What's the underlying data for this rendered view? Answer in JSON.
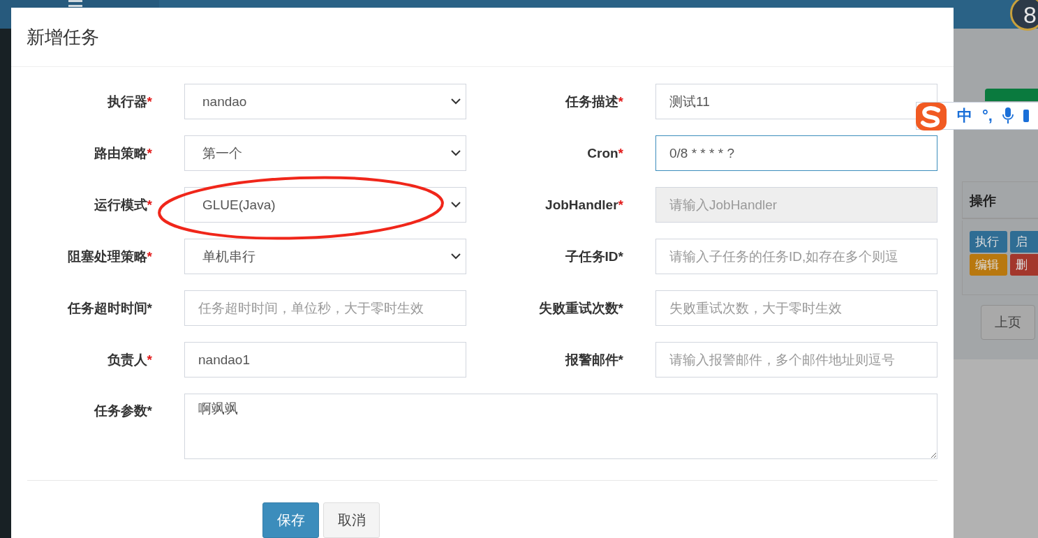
{
  "backdrop": {
    "badge": "8",
    "table_header": "操作",
    "row_actions": [
      {
        "label": "执行",
        "color": "#2f6d94"
      },
      {
        "label": "启",
        "color": "#2f6d94"
      },
      {
        "label": "编辑",
        "color": "#b8780f"
      },
      {
        "label": "删",
        "color": "#a3372c"
      }
    ],
    "pager": [
      "上页"
    ]
  },
  "ime_toolbar": {
    "items": [
      "中",
      "°,"
    ]
  },
  "dialog": {
    "title": "新增任务",
    "fields": [
      {
        "label": "执行器",
        "asterisk": "*",
        "asterisk_red": true,
        "kind": "select",
        "value": "nandao"
      },
      {
        "label": "任务描述",
        "asterisk": "*",
        "asterisk_red": true,
        "kind": "input",
        "value": "测试11"
      },
      {
        "label": "路由策略",
        "asterisk": "*",
        "asterisk_red": true,
        "kind": "select",
        "value": "第一个"
      },
      {
        "label": "Cron",
        "asterisk": "*",
        "asterisk_red": true,
        "kind": "input",
        "value": "0/8 * * * * ?",
        "focused": true
      },
      {
        "label": "运行模式",
        "asterisk": "*",
        "asterisk_red": true,
        "kind": "select",
        "value": "GLUE(Java)"
      },
      {
        "label": "JobHandler",
        "asterisk": "*",
        "asterisk_red": true,
        "kind": "input",
        "placeholder": "请输入JobHandler",
        "disabled": true
      },
      {
        "label": "阻塞处理策略",
        "asterisk": "*",
        "asterisk_red": true,
        "kind": "select",
        "value": "单机串行"
      },
      {
        "label": "子任务ID",
        "asterisk": "*",
        "asterisk_red": false,
        "kind": "input",
        "placeholder": "请输入子任务的任务ID,如存在多个则逗"
      },
      {
        "label": "任务超时时间",
        "asterisk": "*",
        "asterisk_red": false,
        "kind": "input",
        "placeholder": "任务超时时间，单位秒，大于零时生效"
      },
      {
        "label": "失败重试次数",
        "asterisk": "*",
        "asterisk_red": false,
        "kind": "input",
        "placeholder": "失败重试次数，大于零时生效"
      },
      {
        "label": "负责人",
        "asterisk": "*",
        "asterisk_red": true,
        "kind": "input",
        "value": "nandao1"
      },
      {
        "label": "报警邮件",
        "asterisk": "*",
        "asterisk_red": false,
        "kind": "input",
        "placeholder": "请输入报警邮件，多个邮件地址则逗号"
      },
      {
        "label": "任务参数",
        "asterisk": "*",
        "asterisk_red": false,
        "kind": "textarea",
        "value": "啊飒飒"
      }
    ],
    "buttons": [
      {
        "label": "保存",
        "kind": "primary"
      },
      {
        "label": "取消",
        "kind": "default"
      }
    ]
  },
  "annotations": [
    {
      "kind": "ellipse"
    }
  ]
}
